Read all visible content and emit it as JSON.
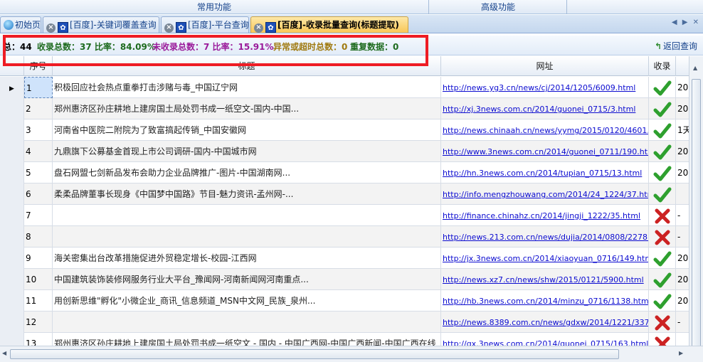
{
  "ribbon": {
    "group1": "常用功能",
    "group2": "高级功能"
  },
  "tabs": [
    {
      "label": "初始页"
    },
    {
      "label": "[百度]-关键词覆盖查询"
    },
    {
      "label": "[百度]-平台查询"
    },
    {
      "label": "[百度]-收录批量查询(标题提取)"
    }
  ],
  "tab_nav": "◀ ▶ ✕",
  "stats": {
    "total": "总：44",
    "included": "收录总数：37 比率：84.09%",
    "not_included": "未收录总数：7 比率：15.91%",
    "abnormal": "异常或超时总数：0",
    "duplicate": "重复数据：0",
    "back_label": "返回查询"
  },
  "grid": {
    "columns": [
      "序号",
      "标题",
      "网址",
      "收录",
      ""
    ],
    "rows": [
      {
        "num": "1",
        "title": "积极回应社会热点重拳打击涉赌与毒_中国辽宁网",
        "url": "http://news.yg3.cn/news/cj/2014/1205/6009.html",
        "included": true,
        "extra": "20"
      },
      {
        "num": "2",
        "title": "郑州惠济区孙庄耕地上建房国土局处罚书成一纸空文-国内-中国...",
        "url": "http://xj.3news.com.cn/2014/guonei_0715/3.html",
        "included": true,
        "extra": "20"
      },
      {
        "num": "3",
        "title": "河南省中医院二附院为了致富搞起传销_中国安徽网",
        "url": "http://news.chinaah.cn/news/yymg/2015/0120/4601.html",
        "included": true,
        "extra": "1天"
      },
      {
        "num": "4",
        "title": "九鼎旗下公募基金首现上市公司调研-国内-中国城市网",
        "url": "http://www.3news.com.cn/2014/guonei_0711/190.html",
        "included": true,
        "extra": "20"
      },
      {
        "num": "5",
        "title": "盘石网盟七剑新品发布会助力企业品牌推广-图片-中国湖南网...",
        "url": "http://hn.3news.com.cn/2014/tupian_0715/13.html",
        "included": true,
        "extra": "20"
      },
      {
        "num": "6",
        "title": "柔柔品牌董事长现身《中国梦中国路》节目-魅力资讯-孟州网-...",
        "url": "http://info.mengzhouwang.com/2014/24_1224/37.html",
        "included": true,
        "extra": ""
      },
      {
        "num": "7",
        "title": "",
        "url": "http://finance.chinahz.cn/2014/jingji_1222/35.html",
        "included": false,
        "extra": "-"
      },
      {
        "num": "8",
        "title": "",
        "url": "http://news.213.com.cn/news/dujia/2014/0808/2278.html",
        "included": false,
        "extra": "-"
      },
      {
        "num": "9",
        "title": "海关密集出台改革措施促进外贸稳定增长-校园-江西网",
        "url": "http://jx.3news.com.cn/2014/xiaoyuan_0716/149.html",
        "included": true,
        "extra": "20"
      },
      {
        "num": "10",
        "title": "中国建筑装饰装修网服务行业大平台_豫闻网-河南新闻网河南重点...",
        "url": "http://news.xz7.cn/news/shw/2015/0121/5900.html",
        "included": true,
        "extra": "20"
      },
      {
        "num": "11",
        "title": "用创新思维\"孵化\"小微企业_商讯_信息频道_MSN中文网_民族_泉州...",
        "url": "http://hb.3news.com.cn/2014/minzu_0716/1138.html",
        "included": true,
        "extra": "20"
      },
      {
        "num": "12",
        "title": "",
        "url": "http://news.8389.com.cn/news/gdxw/2014/1221/3379.html",
        "included": false,
        "extra": "-"
      },
      {
        "num": "13",
        "title": "郑州惠济区孙庄耕地上建房国土局处罚书成一纸空文 - 国内 - 中国广西网-中国广西新闻-中国广西在线",
        "url": "http://gx.3news.com.cn/2014/guonei_0715/163.html",
        "included": false,
        "extra": ""
      }
    ]
  },
  "colors": {
    "accent": "#15428b",
    "check": "#2ea02e",
    "cross": "#cc2222",
    "highlight": "#ee1c24"
  }
}
